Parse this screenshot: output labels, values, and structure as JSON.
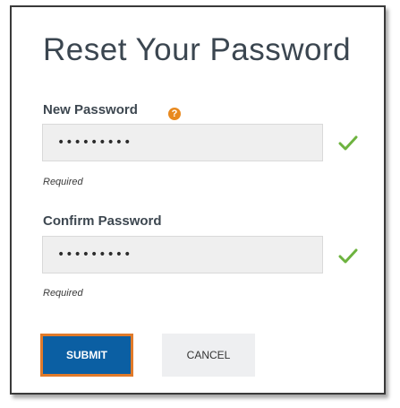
{
  "form": {
    "title": "Reset Your Password",
    "new_password": {
      "label": "New Password",
      "value": "•••••••••",
      "hint": "Required",
      "help_icon": "question-circle-icon",
      "help_glyph": "?",
      "status_icon": "checkmark-icon"
    },
    "confirm_password": {
      "label": "Confirm Password",
      "value": "•••••••••",
      "hint": "Required",
      "status_icon": "checkmark-icon"
    },
    "submit_label": "SUBMIT",
    "cancel_label": "CANCEL"
  },
  "colors": {
    "primary_button": "#0b5fa3",
    "focus_outline": "#e07a2a",
    "valid_check": "#6db33f",
    "help_icon": "#e8891f",
    "title_text": "#3b4650"
  }
}
